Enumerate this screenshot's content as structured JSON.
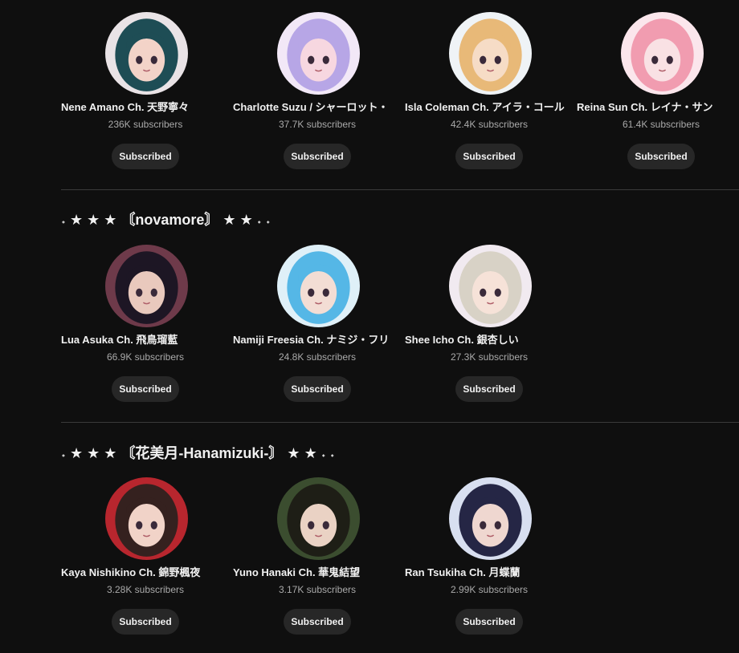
{
  "sections": [
    {
      "title": "",
      "channels": [
        {
          "name": "Nene Amano Ch. 天野寧々",
          "subscribers": "236K subscribers",
          "button": "Subscribed"
        },
        {
          "name": "Charlotte Suzu / シャーロット・",
          "subscribers": "37.7K subscribers",
          "button": "Subscribed"
        },
        {
          "name": "Isla Coleman Ch. アイラ・コール",
          "subscribers": "42.4K subscribers",
          "button": "Subscribed"
        },
        {
          "name": "Reina Sun Ch. レイナ・サン",
          "subscribers": "61.4K subscribers",
          "button": "Subscribed"
        }
      ]
    },
    {
      "title": "˖ ★ ★ ★ 〘novamore〙 ★ ★ ˖ ˖",
      "channels": [
        {
          "name": "Lua Asuka Ch. 飛鳥瑠藍",
          "subscribers": "66.9K subscribers",
          "button": "Subscribed"
        },
        {
          "name": "Namiji Freesia Ch. ナミジ・フリ",
          "subscribers": "24.8K subscribers",
          "button": "Subscribed"
        },
        {
          "name": "Shee Icho Ch. 銀杏しい",
          "subscribers": "27.3K subscribers",
          "button": "Subscribed"
        }
      ]
    },
    {
      "title": "˖ ★ ★ ★ 〘花美月-Hanamizuki-〙 ★ ★ ˖ ˖",
      "channels": [
        {
          "name": "Kaya Nishikino Ch. 錦野楓夜",
          "subscribers": "3.28K subscribers",
          "button": "Subscribed"
        },
        {
          "name": "Yuno Hanaki Ch. 華鬼結望",
          "subscribers": "3.17K subscribers",
          "button": "Subscribed"
        },
        {
          "name": "Ran Tsukiha Ch. 月蝶蘭",
          "subscribers": "2.99K subscribers",
          "button": "Subscribed"
        }
      ]
    }
  ],
  "avatar_colors": [
    [
      "#e9e3e6",
      "#1e4d55",
      "#f3d3c8"
    ],
    [
      "#f2e8f7",
      "#b7a6e6",
      "#f7d7e0"
    ],
    [
      "#eff3f6",
      "#e8b978",
      "#f6dcc6"
    ],
    [
      "#fbe6ec",
      "#f19cb0",
      "#f9e1e4"
    ],
    [
      "#6e3a4a",
      "#1d1624",
      "#e9c9bd"
    ],
    [
      "#dff0f8",
      "#55b7e6",
      "#f3ddd4"
    ],
    [
      "#f1eaf0",
      "#d8d2c6",
      "#f6e2d8"
    ],
    [
      "#b8262e",
      "#35211f",
      "#f1d3c8"
    ],
    [
      "#3b4d2f",
      "#1e1e16",
      "#ead2c4"
    ],
    [
      "#d8dff0",
      "#252645",
      "#efd7d0"
    ]
  ]
}
